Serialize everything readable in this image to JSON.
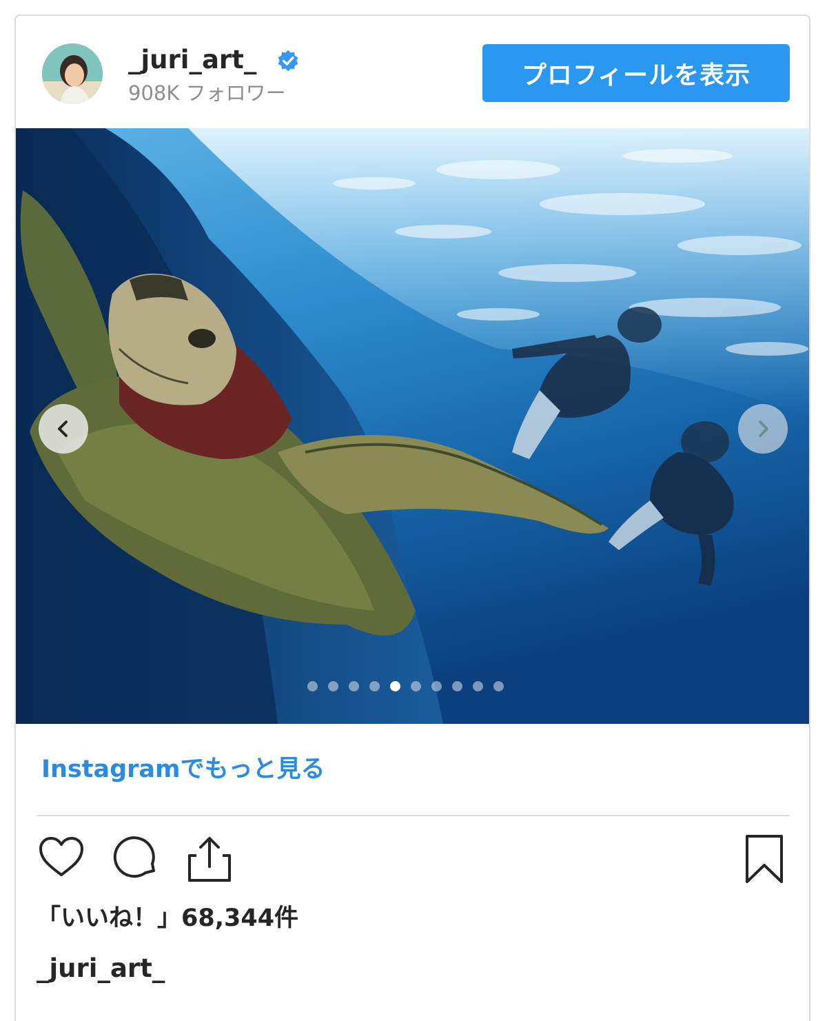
{
  "header": {
    "username": "_juri_art_",
    "followers": "908K フォロワー",
    "profile_button": "プロフィールを表示"
  },
  "post": {
    "carousel": {
      "slide_count": 10,
      "active_index": 4
    },
    "more_link": "Instagramでもっと見る",
    "likes_text": "「いいね！」68,344件",
    "caption_user": "_juri_art_"
  },
  "icons": {
    "verified": "verified-badge-icon",
    "prev": "chevron-left-icon",
    "next": "chevron-right-icon",
    "like": "heart-icon",
    "comment": "comment-icon",
    "share": "share-icon",
    "save": "bookmark-icon"
  },
  "colors": {
    "accent": "#2a97f0",
    "link": "#2a8cdf",
    "secondary_text": "#8e8e8e",
    "border": "#dbdbdb"
  }
}
